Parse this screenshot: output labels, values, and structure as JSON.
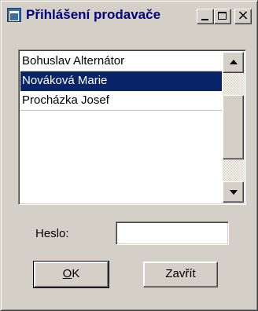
{
  "window": {
    "title": "Přihlášení prodavače",
    "controls": {
      "minimize_icon": "minimize-icon",
      "maximize_icon": "maximize-icon",
      "close_glyph": "×"
    }
  },
  "users_list": {
    "items": [
      {
        "label": "Bohuslav Alternátor",
        "selected": false
      },
      {
        "label": "Nováková Marie",
        "selected": true
      },
      {
        "label": "Procházka Josef",
        "selected": false
      }
    ]
  },
  "password": {
    "label": "Heslo:",
    "value": "",
    "placeholder": ""
  },
  "buttons": {
    "ok": {
      "mnemonic": "O",
      "rest": "K"
    },
    "close": {
      "label": "Zavřít"
    }
  }
}
